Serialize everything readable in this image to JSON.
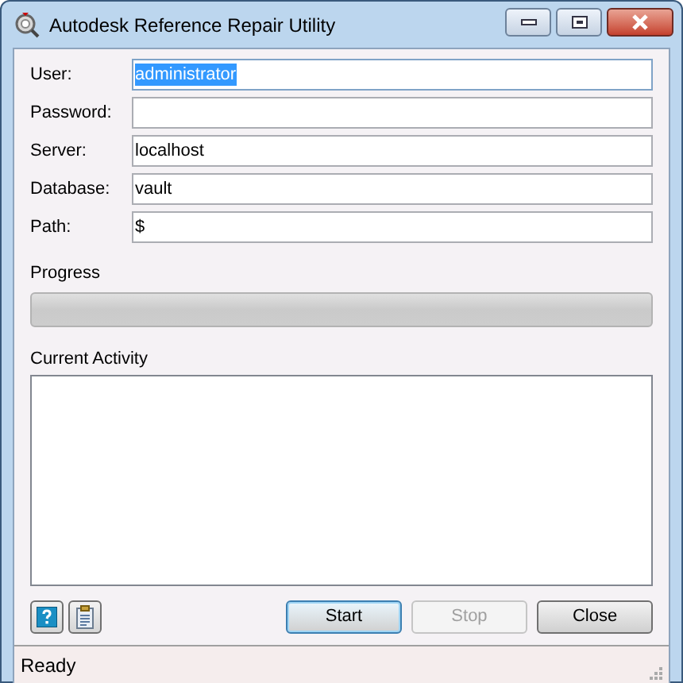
{
  "window": {
    "title": "Autodesk Reference Repair Utility"
  },
  "fields": [
    {
      "label": "User:",
      "value": "administrator",
      "text_selected": true
    },
    {
      "label": "Password:",
      "text_selected": false
    },
    {
      "label": "Server:",
      "value": "localhost",
      "text_selected": false
    },
    {
      "label": "Database:",
      "value": "vault",
      "text_selected": false
    },
    {
      "label": "Path:",
      "value": "$",
      "text_selected": false
    }
  ],
  "progress": {
    "label": "Progress",
    "level": 0
  },
  "activity": {
    "label": "Current Activity"
  },
  "buttons": [
    {
      "label": "Start",
      "disabled": false,
      "focused": true
    },
    {
      "label": "Stop",
      "disabled": true,
      "focused": false
    },
    {
      "label": "Close",
      "disabled": false,
      "focused": false
    }
  ],
  "status_bar": {
    "text": "Ready"
  }
}
